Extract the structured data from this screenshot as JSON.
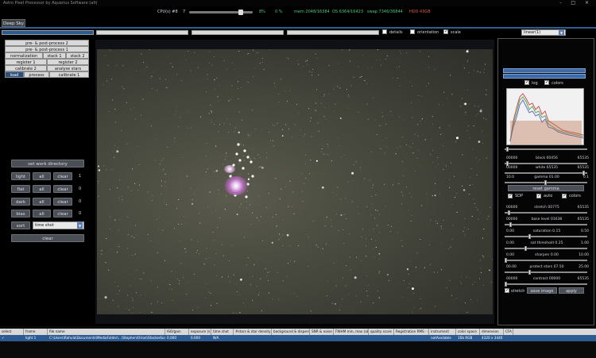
{
  "window": {
    "title": "Astro Pixel Processor by Aquarius Software (alt)",
    "controls": "- □ ×"
  },
  "status": {
    "cpu_label": "CPU(s) #8",
    "cpu_value": "7",
    "cpu_percent": "8%",
    "progress_percent": "0 %",
    "mem": "mem 2048/16384",
    "os": "OS 6364/16423",
    "swap": "swap 7346/36844",
    "hdd": "HDD 43GB"
  },
  "tabs": {
    "main": "Deep Sky"
  },
  "toolbar": {
    "details_label": "details",
    "orientation_label": "orientation",
    "scale_label": "scale",
    "stretch_mode": "linear(1)"
  },
  "left_tabs": {
    "row1": [
      "pre- & post-process 2"
    ],
    "row2": [
      "pre- & post-process 1"
    ],
    "row3": [
      "normalization",
      "stack 1",
      "stack 2"
    ],
    "row4": [
      "register 1",
      "register 2"
    ],
    "row5": [
      "calibrate 2",
      "analyse stars"
    ],
    "row6": [
      "load",
      "process",
      "calibrate 1"
    ]
  },
  "load_panel": {
    "work_directory_button": "set work directory",
    "frame_types": [
      {
        "type": "light",
        "all": "all",
        "clear": "clear",
        "count": "1"
      },
      {
        "type": "flat",
        "all": "all",
        "clear": "clear",
        "count": "0"
      },
      {
        "type": "dark",
        "all": "all",
        "clear": "clear",
        "count": "0"
      },
      {
        "type": "bias",
        "all": "all",
        "clear": "clear",
        "count": "0"
      }
    ],
    "sort_label": "sort",
    "sort_value": "time shot",
    "clear_button": "clear"
  },
  "right_panel": {
    "log_label": "log",
    "colors_label": "colors",
    "sliders": [
      {
        "min": "00000",
        "label": "black 00456",
        "max": "65535",
        "level": 0.02
      },
      {
        "min": "00000",
        "label": "white 65535",
        "max": "65535",
        "level": 0.98
      },
      {
        "min": "10.0",
        "label": "gamma 01.00",
        "max": "0.1",
        "level": 0.5
      }
    ],
    "reset_gamma": "reset gamma",
    "sdp_label": "SDP",
    "auto_label": "auto",
    "colors2_label": "colors",
    "sliders2": [
      {
        "min": "00000",
        "label": "stretch 00775",
        "max": "65535",
        "level": 0.04
      },
      {
        "min": "00000",
        "label": "base level 01638",
        "max": "65535",
        "level": 0.06
      },
      {
        "min": "0.00",
        "label": "saturation 0.15",
        "max": "0.50",
        "level": 0.3
      },
      {
        "min": "0.00",
        "label": "sat threshold 0.25",
        "max": "1.00",
        "level": 0.25
      },
      {
        "min": "0.00",
        "label": "sharpen 0.00",
        "max": "10.00",
        "level": 0.0
      },
      {
        "min": "00.00",
        "label": "protect stars 07.50",
        "max": "25.00",
        "level": 0.3
      },
      {
        "min": "00000",
        "label": "contrast 00000",
        "max": "65535",
        "level": 0.0
      }
    ],
    "stretch_label": "stretch",
    "save_image": "save image",
    "apply": "apply"
  },
  "file_table": {
    "headers": [
      "select",
      "frame",
      "file name",
      "ISO/gain",
      "exposure (s)",
      "time shot",
      "#stars & star density",
      "background & dispersion",
      "SNR & noise",
      "FWHM min, max (abs & rel)",
      "quality score",
      "Registration RMS - #stars",
      "instrument",
      "color space",
      "dimension",
      "CFA"
    ],
    "rows": [
      [
        "✓",
        "light 1",
        "C:\\Users\\Rahula\\Documents\\MediaFolder\\...\\Stephen\\Orion\\Stacked\\orion\\stack1e16.TIF",
        "0.000",
        "0.000",
        "N/A",
        "",
        "",
        "",
        "",
        "",
        "",
        "notAvailable",
        "16b RGB",
        "4320 x 3440",
        ""
      ]
    ]
  }
}
